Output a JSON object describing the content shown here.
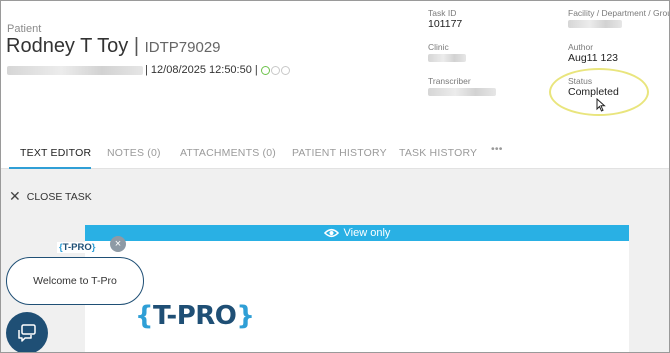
{
  "patient": {
    "label": "Patient",
    "name": "Rodney T Toy",
    "separator": "|",
    "id": "IDTP79029",
    "timestamp": "| 12/08/2025 12:50:50 |"
  },
  "meta": {
    "task_id_label": "Task ID",
    "task_id_value": "101177",
    "facility_label": "Facility / Department / Group",
    "clinic_label": "Clinic",
    "author_label": "Author",
    "author_value": "Aug11 123",
    "transcriber_label": "Transcriber",
    "status_label": "Status",
    "status_value": "Completed"
  },
  "tabs": [
    {
      "label": "TEXT EDITOR",
      "active": true
    },
    {
      "label": "NOTES (0)"
    },
    {
      "label": "ATTACHMENTS (0)"
    },
    {
      "label": "PATIENT HISTORY"
    },
    {
      "label": "TASK HISTORY"
    },
    {
      "label": "•••"
    }
  ],
  "close_task": {
    "icon": "close-icon",
    "label": "CLOSE TASK"
  },
  "viewer": {
    "view_only_label": "View only",
    "icon": "eye-icon"
  },
  "logo": {
    "open_brace": "{",
    "text": "T-PRO",
    "close_brace": "}"
  },
  "chat": {
    "bubble_text": "Welcome to T-Pro",
    "close_glyph": "×",
    "icon": "chat-icon"
  },
  "colors": {
    "accent": "#2f9fd6",
    "view_only_bar": "#29b0e4",
    "brand_dark": "#1f4f75",
    "highlight": "#e9e57d"
  }
}
